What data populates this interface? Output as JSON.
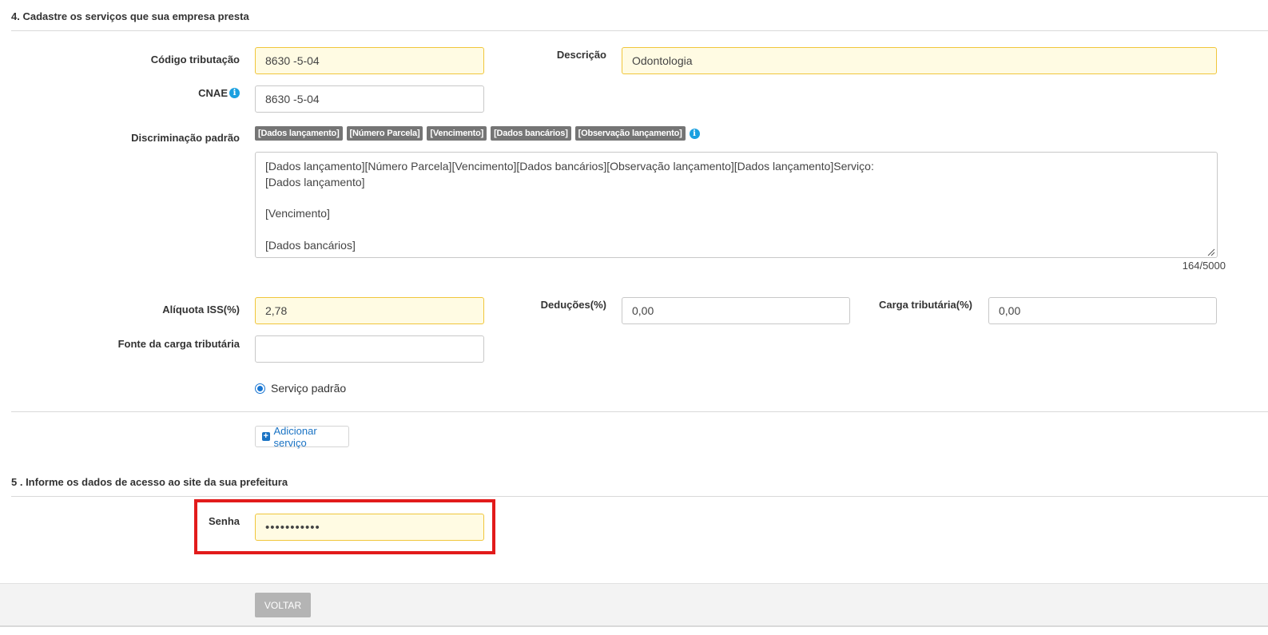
{
  "section4": {
    "title": "4. Cadastre os serviços que sua empresa presta",
    "codigo_label": "Código tributação",
    "codigo_value": "8630 -5-04",
    "descricao_label": "Descrição",
    "descricao_value": "Odontologia",
    "cnae_label": "CNAE",
    "cnae_value": "8630 -5-04",
    "discriminacao_label": "Discriminação padrão",
    "tags": [
      "[Dados lançamento]",
      "[Número Parcela]",
      "[Vencimento]",
      "[Dados bancários]",
      "[Observação lançamento]"
    ],
    "discriminacao_text": "[Dados lançamento][Número Parcela][Vencimento][Dados bancários][Observação lançamento][Dados lançamento]Serviço:\n[Dados lançamento]\n\n[Vencimento]\n\n[Dados bancários]",
    "char_count": "164/5000",
    "aliquota_label": "Alíquota ISS(%)",
    "aliquota_value": "2,78",
    "deducoes_label": "Deduções(%)",
    "deducoes_value": "0,00",
    "carga_label": "Carga tributária(%)",
    "carga_value": "0,00",
    "fonte_label": "Fonte da carga tributária",
    "fonte_value": "",
    "servico_padrao_label": "Serviço padrão",
    "add_servico_label": "Adicionar serviço"
  },
  "section5": {
    "title": "5 . Informe os dados de acesso ao site da sua prefeitura",
    "senha_label": "Senha",
    "senha_value": "•••••••••••"
  },
  "footer": {
    "voltar_label": "VOLTAR"
  },
  "colors": {
    "highlight_field_bg": "#fffbe3",
    "highlight_field_border": "#f0c63b",
    "annotation_box": "#e21b1b",
    "link_blue": "#1a73c4",
    "info_icon": "#1aa0e0"
  }
}
